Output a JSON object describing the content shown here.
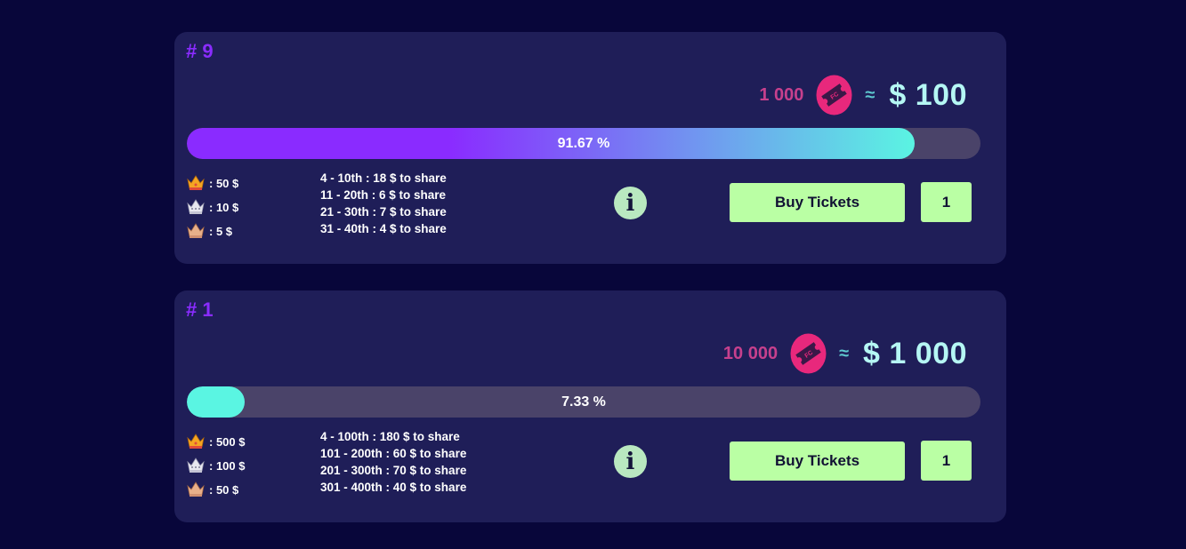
{
  "colors": {
    "page_bg": "#08063a",
    "card_bg": "#1f1e58",
    "accent_purple": "#8a2cff",
    "ticket_pink": "#e8287c",
    "buy_green": "#baffa4",
    "usd_cyan": "#b5f7f4"
  },
  "lotteries": [
    {
      "title": "# 9",
      "ticket_amount": "1 000",
      "ticket_icon": "ticket-icon",
      "approx_symbol": "≈",
      "usd_value": "$ 100",
      "progress_fraction": 0.9167,
      "progress_label": "91.67 %",
      "top_prizes": [
        {
          "icon": "gold-crown-icon",
          "text": ": 50 $"
        },
        {
          "icon": "silver-crown-icon",
          "text": ": 10 $"
        },
        {
          "icon": "bronze-crown-icon",
          "text": ": 5 $"
        }
      ],
      "ranges": [
        "4 - 10th : 18 $ to share",
        "11 - 20th : 6 $ to share",
        "21 - 30th : 7 $ to share",
        "31 - 40th : 4 $ to share"
      ],
      "info_label": "i",
      "buy_label": "Buy Tickets",
      "quantity": "1"
    },
    {
      "title": "# 1",
      "ticket_amount": "10 000",
      "ticket_icon": "ticket-icon",
      "approx_symbol": "≈",
      "usd_value": "$ 1 000",
      "progress_fraction": 0.0733,
      "progress_label": "7.33 %",
      "top_prizes": [
        {
          "icon": "gold-crown-icon",
          "text": ": 500 $"
        },
        {
          "icon": "silver-crown-icon",
          "text": ": 100 $"
        },
        {
          "icon": "bronze-crown-icon",
          "text": ": 50 $"
        }
      ],
      "ranges": [
        "4 - 100th : 180 $ to share",
        "101 - 200th : 60 $ to share",
        "201 - 300th : 70 $ to share",
        "301 - 400th : 40 $ to share"
      ],
      "info_label": "i",
      "buy_label": "Buy Tickets",
      "quantity": "1"
    }
  ]
}
